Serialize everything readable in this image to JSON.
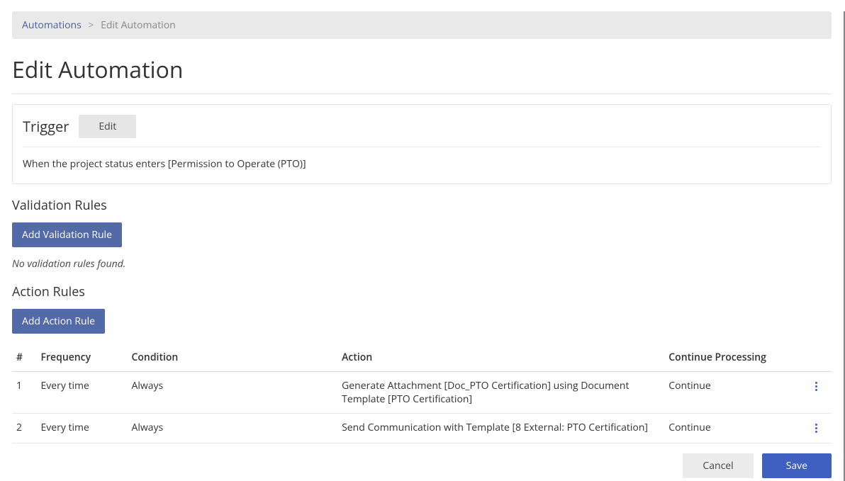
{
  "breadcrumb": {
    "root": "Automations",
    "current": "Edit Automation"
  },
  "page_title": "Edit Automation",
  "trigger": {
    "title": "Trigger",
    "edit_label": "Edit",
    "description": "When the project status enters [Permission to Operate (PTO)]"
  },
  "validation": {
    "title": "Validation Rules",
    "add_label": "Add Validation Rule",
    "empty_message": "No validation rules found."
  },
  "action_rules": {
    "title": "Action Rules",
    "add_label": "Add Action Rule",
    "headers": {
      "num": "#",
      "frequency": "Frequency",
      "condition": "Condition",
      "action": "Action",
      "continue": "Continue Processing"
    },
    "rows": [
      {
        "num": "1",
        "frequency": "Every time",
        "condition": "Always",
        "action": "Generate Attachment [Doc_PTO Certification] using Document Template [PTO Certification]",
        "continue": "Continue"
      },
      {
        "num": "2",
        "frequency": "Every time",
        "condition": "Always",
        "action": "Send Communication with Template [8 External: PTO Certification]",
        "continue": "Continue"
      }
    ]
  },
  "footer": {
    "cancel": "Cancel",
    "save": "Save"
  }
}
